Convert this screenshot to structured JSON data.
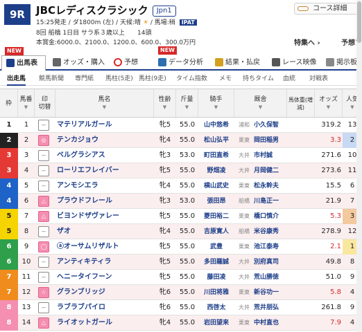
{
  "header": {
    "race_number": "9R",
    "race_name": "JBCレディスクラシック",
    "grade": "Jpn1",
    "info_line1": "15:25発走 / ダ1800m (左) / 天候:晴",
    "weather_icon": "sun-icon",
    "baba": "/ 馬場:稍",
    "ipat": "IPAT",
    "info_line2": "8回 船橋 1日目 サラ系３歳以上　　14頭",
    "info_line3": "本賞金:6000.0、2100.0、1200.0、600.0、300.0万円",
    "course_button": "コース詳細",
    "special": "特集へ ›",
    "special2": "予想プロ"
  },
  "tabs": [
    {
      "label": "出馬表",
      "icon": "table-icon",
      "active": true,
      "new": true
    },
    {
      "label": "オッズ・購入",
      "icon": "odds-icon",
      "active": false,
      "new": false
    },
    {
      "label": "予想",
      "icon": "target-icon",
      "active": false,
      "new": false
    },
    {
      "label": "データ分析",
      "icon": "data-icon",
      "active": false,
      "new": true
    },
    {
      "label": "結果・払戻",
      "icon": "result-icon",
      "active": false,
      "new": false
    },
    {
      "label": "レース映像",
      "icon": "video-icon",
      "active": false,
      "new": false
    },
    {
      "label": "掲示板",
      "icon": "board-icon",
      "active": false,
      "new": false
    }
  ],
  "new_badge": "NEW",
  "subnav": [
    "出走馬",
    "競馬新聞",
    "専門紙",
    "馬柱(5走)",
    "馬柱(9走)",
    "タイム指数",
    "メモ",
    "持ちタイム",
    "血統",
    "対戦表"
  ],
  "columns": {
    "waku": "枠",
    "umaban": "馬番",
    "mark": "印",
    "mark_sub": "切替",
    "name": "馬名",
    "sexage": "性齢",
    "weight": "斤量",
    "jockey": "騎手",
    "trainer": "厩舎",
    "bw": "馬体重(増減)",
    "odds": "オッズ",
    "pop": "人気"
  },
  "colors": {
    "waku1": "#ffffff",
    "waku2": "#222222",
    "waku3": "#e53935",
    "waku4": "#1e63c8",
    "waku5": "#f5d400",
    "waku6": "#2e9f4b",
    "waku7": "#f08c1e",
    "waku8": "#f48fb1"
  },
  "horses": [
    {
      "waku": "1",
      "umaban": "1",
      "mark": "--",
      "name": "マテリアルガール",
      "sexage": "牝5",
      "weight": "55.0",
      "jockey": "山中悠希",
      "affil": "浦和",
      "trainer": "小久保智",
      "bw": "",
      "odds": "319.2",
      "pop": "13",
      "low": false,
      "marktype": "plain"
    },
    {
      "waku": "2",
      "umaban": "2",
      "mark": "◎",
      "name": "テンカジョウ",
      "sexage": "牝4",
      "weight": "55.0",
      "jockey": "松山弘平",
      "affil": "栗東",
      "trainer": "岡田稲男",
      "bw": "",
      "odds": "3.3",
      "pop": "2",
      "low": true,
      "marktype": "pink"
    },
    {
      "waku": "3",
      "umaban": "3",
      "mark": "--",
      "name": "ベルグラシアス",
      "sexage": "牝3",
      "weight": "53.0",
      "jockey": "町田直希",
      "affil": "大井",
      "trainer": "市村誠",
      "bw": "",
      "odds": "271.6",
      "pop": "10",
      "low": false,
      "marktype": "plain"
    },
    {
      "waku": "3",
      "umaban": "4",
      "mark": "--",
      "name": "ローリエフレイバー",
      "sexage": "牝5",
      "weight": "55.0",
      "jockey": "野畑凌",
      "affil": "大井",
      "trainer": "月岡健二",
      "bw": "",
      "odds": "273.6",
      "pop": "11",
      "low": false,
      "marktype": "plain"
    },
    {
      "waku": "4",
      "umaban": "5",
      "mark": "--",
      "name": "アンモシエラ",
      "sexage": "牝4",
      "weight": "55.0",
      "jockey": "横山武史",
      "affil": "栗東",
      "trainer": "松永幹夫",
      "bw": "",
      "odds": "15.5",
      "pop": "6",
      "low": false,
      "marktype": "plain"
    },
    {
      "waku": "4",
      "umaban": "6",
      "mark": "△",
      "name": "プラウドフレール",
      "sexage": "牝3",
      "weight": "53.0",
      "jockey": "張田昂",
      "affil": "船橋",
      "trainer": "川島正一",
      "bw": "",
      "odds": "21.9",
      "pop": "7",
      "low": false,
      "marktype": "pink"
    },
    {
      "waku": "5",
      "umaban": "7",
      "mark": "△",
      "name": "ビヨンドザヴァレー",
      "sexage": "牝5",
      "weight": "55.0",
      "jockey": "菱田裕二",
      "affil": "栗東",
      "trainer": "橋口慎介",
      "bw": "",
      "odds": "5.3",
      "pop": "3",
      "low": true,
      "marktype": "pink"
    },
    {
      "waku": "5",
      "umaban": "8",
      "mark": "--",
      "name": "ザオ",
      "sexage": "牝4",
      "weight": "55.0",
      "jockey": "吉原寛人",
      "affil": "船橋",
      "trainer": "米谷康秀",
      "bw": "",
      "odds": "278.9",
      "pop": "12",
      "low": false,
      "marktype": "plain"
    },
    {
      "waku": "6",
      "umaban": "9",
      "mark": "◯",
      "name": "ⓐオーサムリザルト",
      "sexage": "牝5",
      "weight": "55.0",
      "jockey": "武豊",
      "affil": "栗東",
      "trainer": "池江泰寿",
      "bw": "",
      "odds": "2.1",
      "pop": "1",
      "low": true,
      "marktype": "pink"
    },
    {
      "waku": "6",
      "umaban": "10",
      "mark": "--",
      "name": "アンティキティラ",
      "sexage": "牝5",
      "weight": "55.0",
      "jockey": "多田羅誠",
      "affil": "大井",
      "trainer": "別府真司",
      "bw": "",
      "odds": "49.8",
      "pop": "8",
      "low": false,
      "marktype": "plain"
    },
    {
      "waku": "7",
      "umaban": "11",
      "mark": "--",
      "name": "ヘニータイフーン",
      "sexage": "牝5",
      "weight": "55.0",
      "jockey": "藤田凌",
      "affil": "大井",
      "trainer": "荒山勝徳",
      "bw": "",
      "odds": "51.0",
      "pop": "9",
      "low": false,
      "marktype": "plain"
    },
    {
      "waku": "7",
      "umaban": "12",
      "mark": "☆",
      "name": "グランブリッジ",
      "sexage": "牝6",
      "weight": "55.0",
      "jockey": "川田将雅",
      "affil": "栗東",
      "trainer": "新谷功一",
      "bw": "",
      "odds": "5.8",
      "pop": "4",
      "low": true,
      "marktype": "pink"
    },
    {
      "waku": "8",
      "umaban": "13",
      "mark": "--",
      "name": "ラブラブパイロ",
      "sexage": "牝6",
      "weight": "55.0",
      "jockey": "西啓太",
      "affil": "大井",
      "trainer": "荒井朋弘",
      "bw": "",
      "odds": "261.8",
      "pop": "9",
      "low": false,
      "marktype": "plain"
    },
    {
      "waku": "8",
      "umaban": "14",
      "mark": "△",
      "name": "ライオットガール",
      "sexage": "牝4",
      "weight": "55.0",
      "jockey": "岩田望来",
      "affil": "栗東",
      "trainer": "中村直也",
      "bw": "",
      "odds": "7.9",
      "pop": "4",
      "low": true,
      "marktype": "pink"
    }
  ]
}
